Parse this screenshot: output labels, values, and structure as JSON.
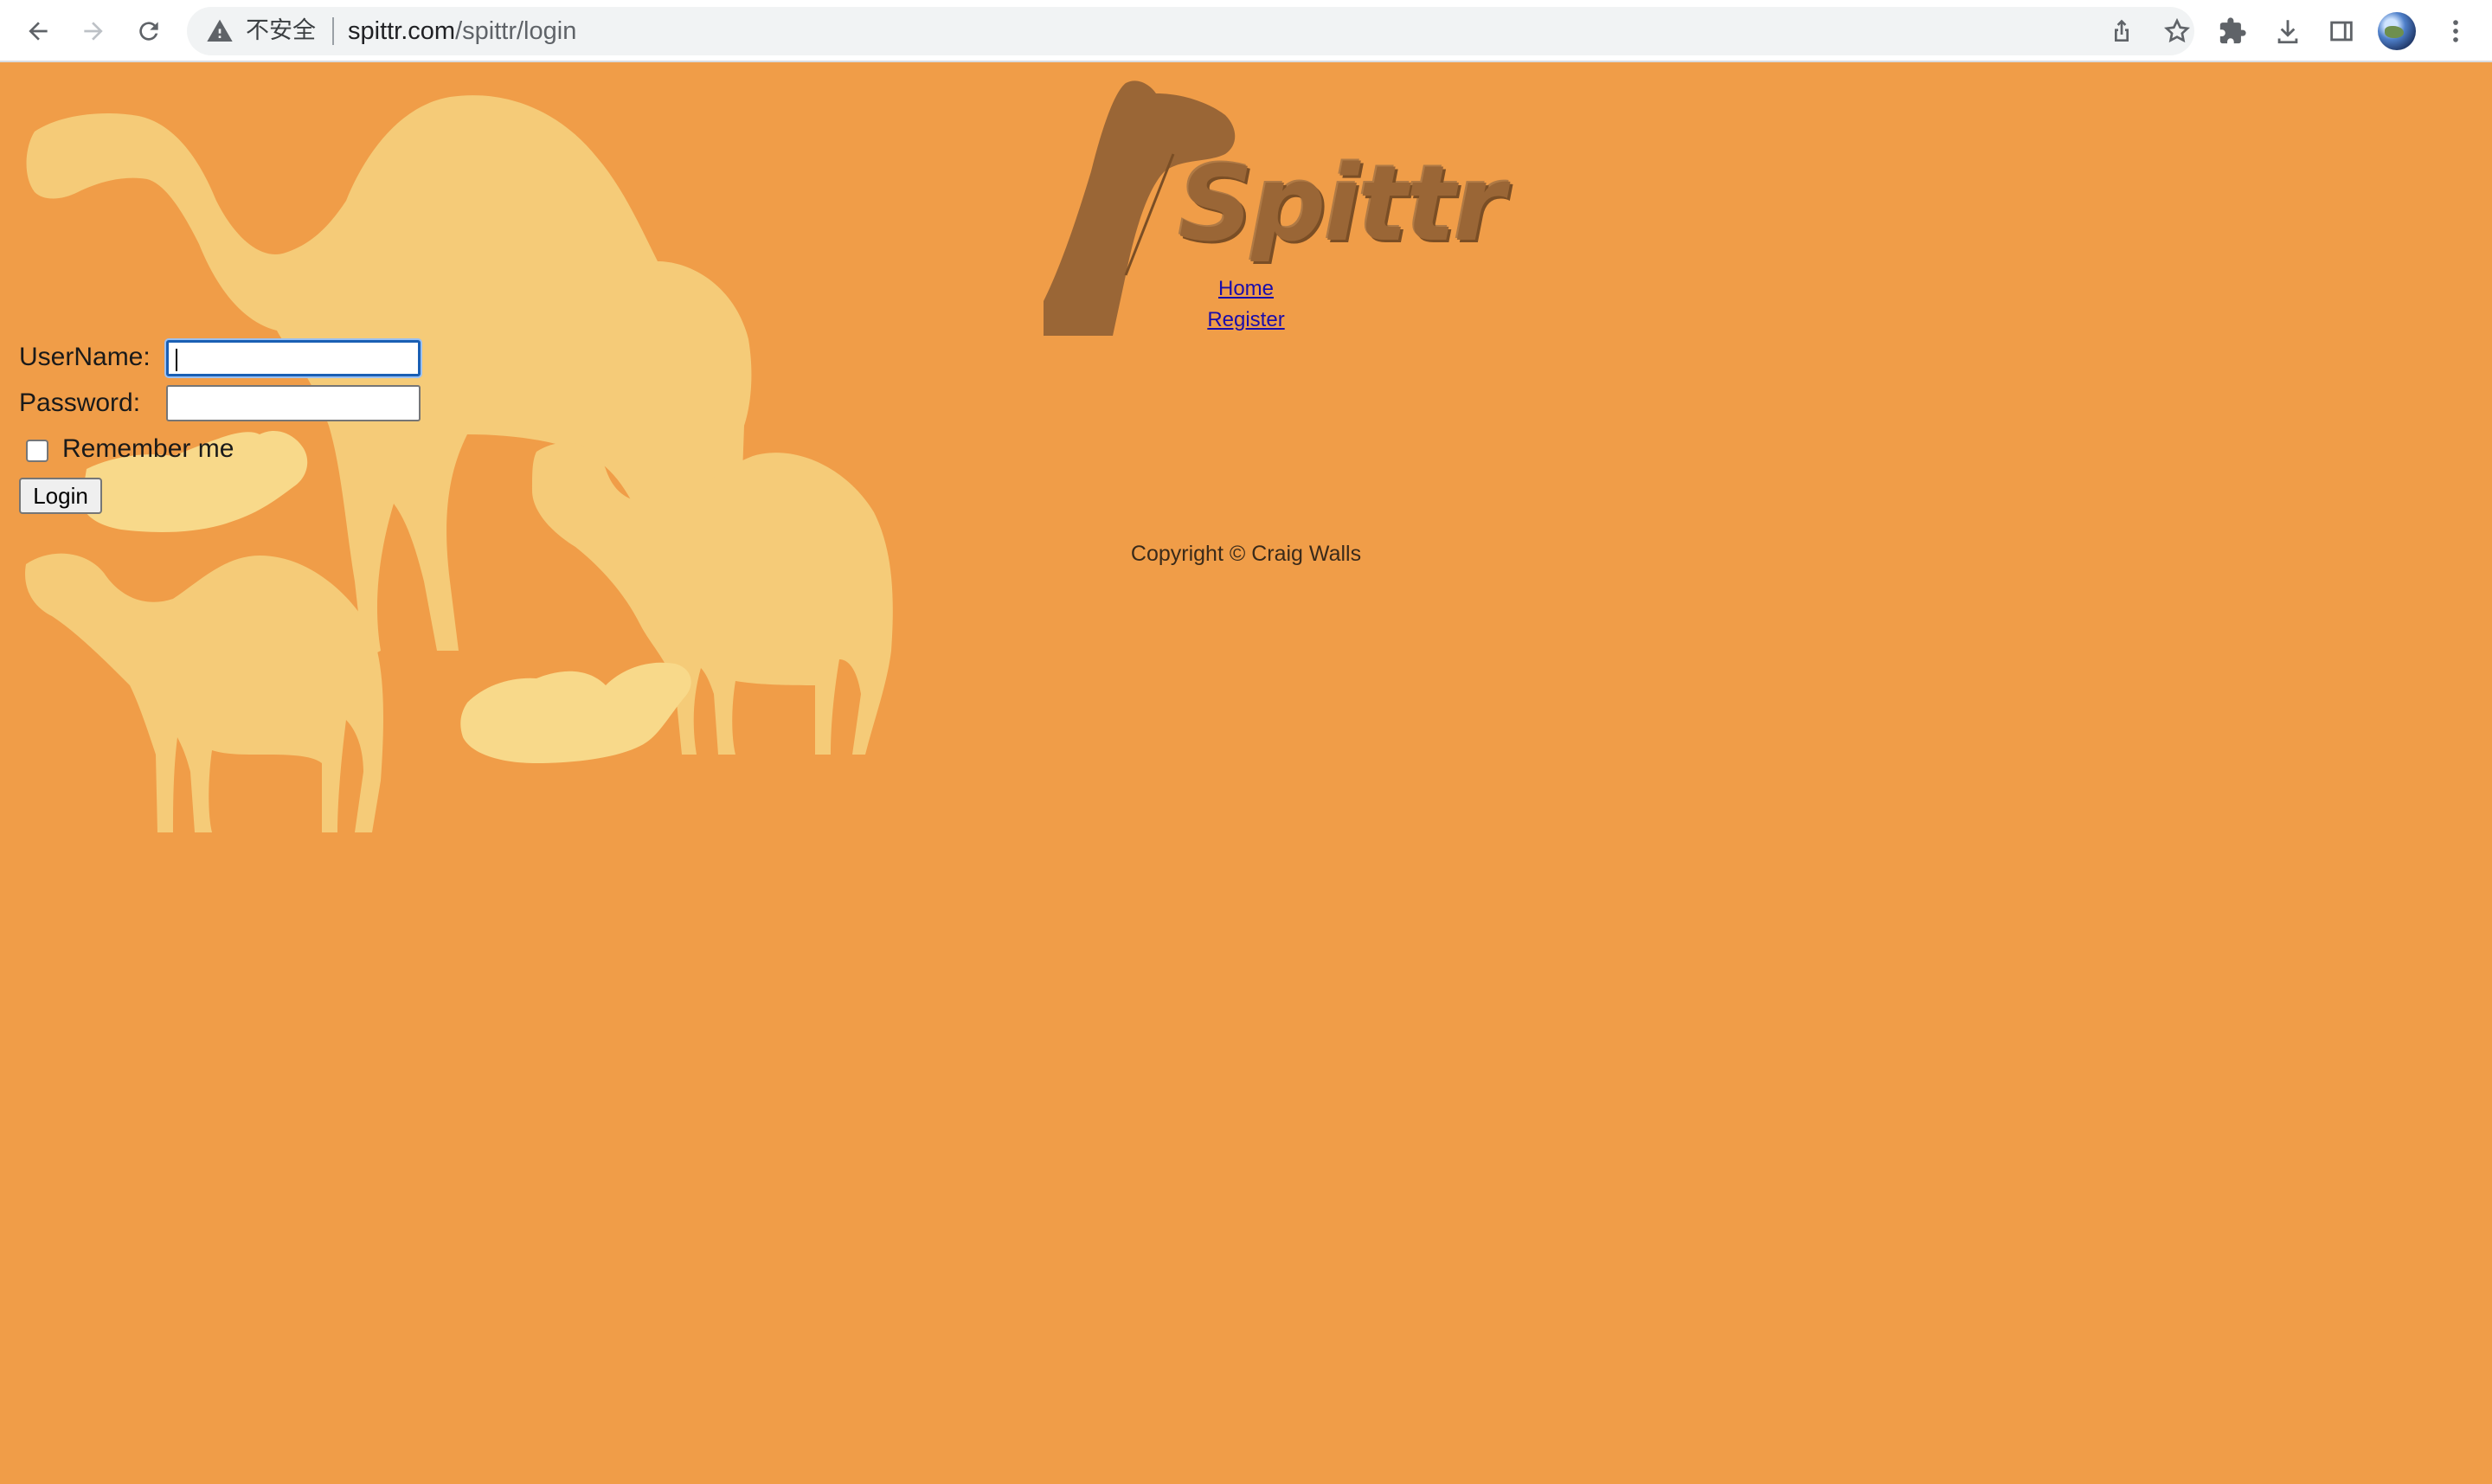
{
  "browser": {
    "security_label": "不安全",
    "url_host": "spittr.com",
    "url_path": "/spittr/login",
    "icons": {
      "back": "back-arrow-icon",
      "forward": "forward-arrow-icon",
      "reload": "reload-icon",
      "security": "warning-triangle-icon",
      "share": "share-icon",
      "bookmark": "star-icon",
      "extensions": "puzzle-icon",
      "downloads": "download-icon",
      "side_panel": "side-panel-icon",
      "profile": "avatar",
      "menu": "kebab-menu-icon"
    }
  },
  "logo": {
    "text": "Spittr"
  },
  "nav": {
    "home": "Home",
    "register": "Register"
  },
  "form": {
    "username_label": "UserName:",
    "username_value": "",
    "password_label": "Password:",
    "password_value": "",
    "remember_label": "Remember me",
    "remember_checked": false,
    "login_label": "Login"
  },
  "footer": {
    "copyright": "Copyright © Craig Walls"
  },
  "colors": {
    "page_background": "#f09d48",
    "camel_silhouette": "#f5cb78",
    "logo_brown": "#9a6636",
    "link": "#1a0dab"
  }
}
